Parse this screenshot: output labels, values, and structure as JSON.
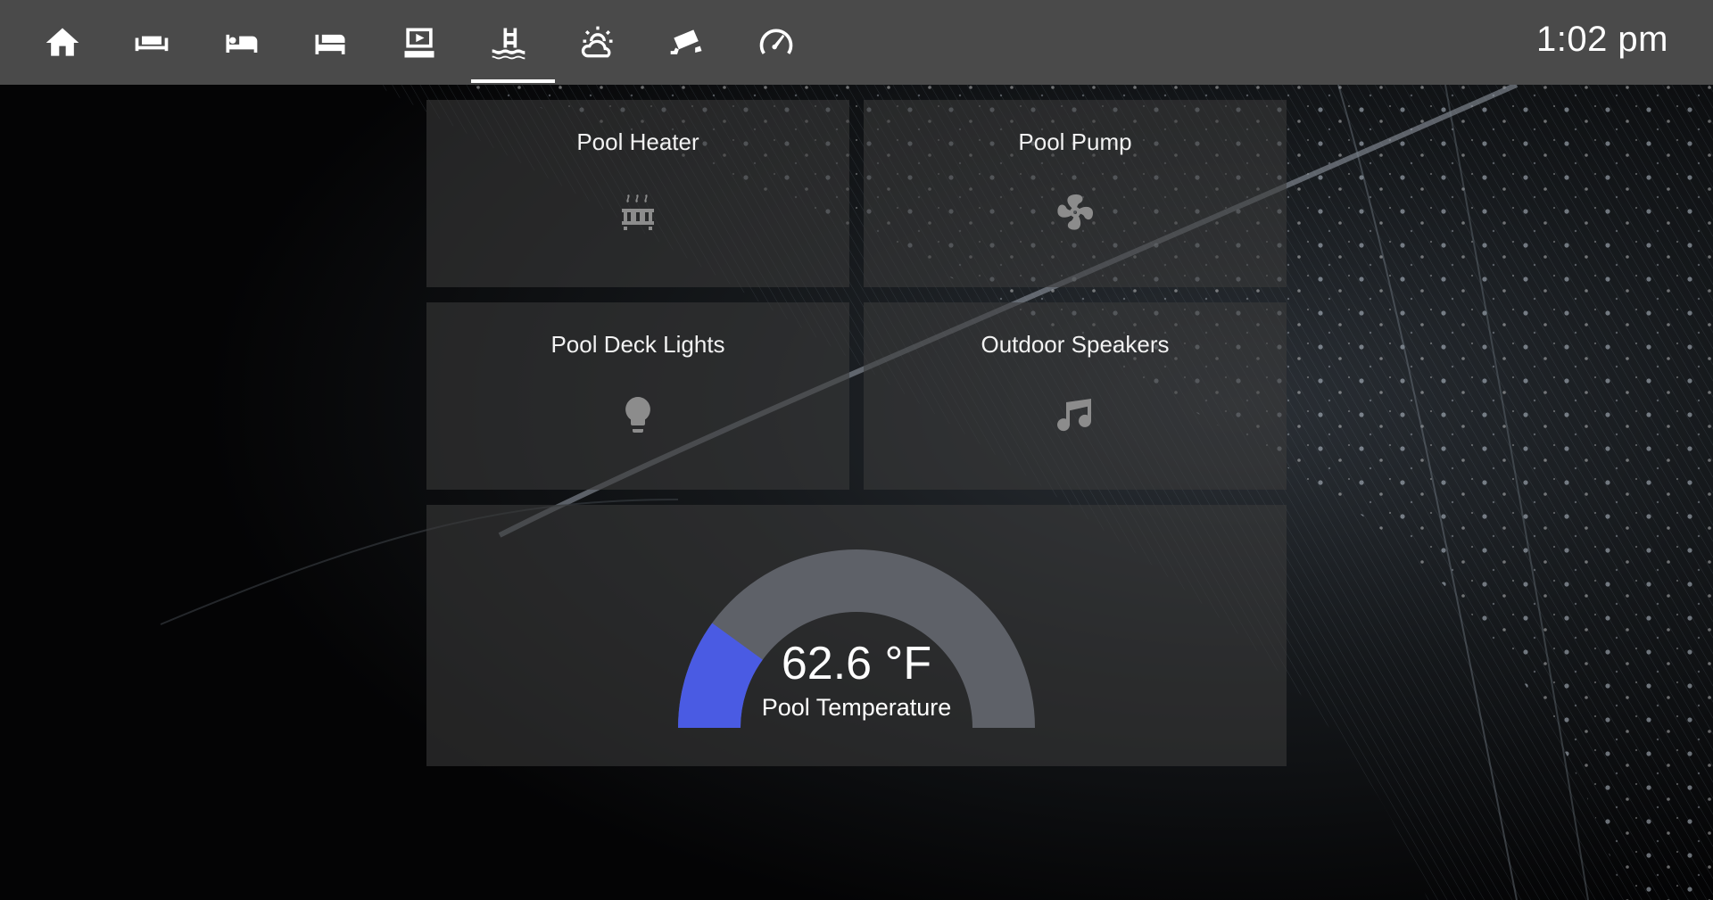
{
  "topbar": {
    "tabs": [
      {
        "icon": "home-icon",
        "active": false
      },
      {
        "icon": "sofa-icon",
        "active": false
      },
      {
        "icon": "bed-icon",
        "active": false
      },
      {
        "icon": "bed-single-icon",
        "active": false
      },
      {
        "icon": "theater-icon",
        "active": false
      },
      {
        "icon": "pool-icon",
        "active": true
      },
      {
        "icon": "weather-partly-cloudy-icon",
        "active": false
      },
      {
        "icon": "cctv-icon",
        "active": false
      },
      {
        "icon": "speedometer-icon",
        "active": false
      }
    ],
    "clock": "1:02 pm"
  },
  "cards": {
    "pool_heater": {
      "title": "Pool Heater",
      "icon": "radiator-icon",
      "state": "off"
    },
    "pool_pump": {
      "title": "Pool Pump",
      "icon": "fan-icon",
      "state": "off"
    },
    "pool_deck_lights": {
      "title": "Pool Deck Lights",
      "icon": "lightbulb-icon",
      "state": "off"
    },
    "outdoor_speakers": {
      "title": "Outdoor Speakers",
      "icon": "music-note-icon",
      "state": "off"
    }
  },
  "gauge": {
    "value": "62.6 °F",
    "label": "Pool Temperature",
    "fill_fraction": 0.2
  },
  "colors": {
    "topbar": "#4a4a4a",
    "card": "#3a3a3a",
    "gauge_track": "#5e6168",
    "gauge_fill": "#4a5be3",
    "icon_inactive": "#8c8c8c",
    "icon_topbar": "#ffffff"
  }
}
